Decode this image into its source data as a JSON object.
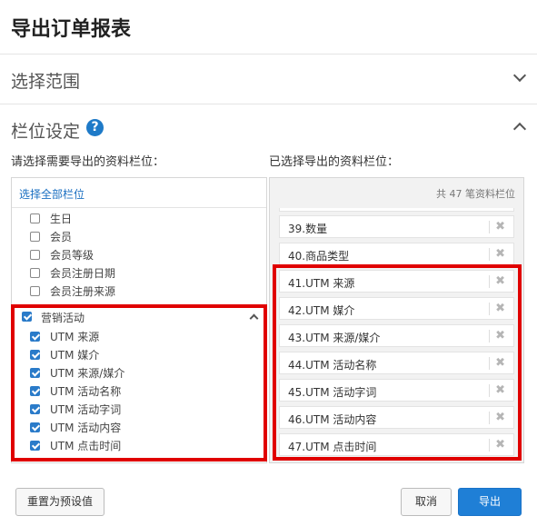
{
  "header": {
    "title": "导出订单报表"
  },
  "sections": {
    "scope": {
      "label": "选择范围"
    },
    "fields": {
      "label": "栏位设定",
      "help_glyph": "?"
    }
  },
  "left_caption": "请选择需要导出的资料栏位：",
  "right_caption": "已选择导出的资料栏位：",
  "left_panel": {
    "select_all": "选择全部栏位",
    "items": [
      {
        "label": "生日",
        "checked": false
      },
      {
        "label": "会员",
        "checked": false
      },
      {
        "label": "会员等级",
        "checked": false
      },
      {
        "label": "会员注册日期",
        "checked": false
      },
      {
        "label": "会员注册来源",
        "checked": false
      }
    ],
    "group": {
      "label": "营销活动",
      "checked": true,
      "items": [
        {
          "label": "UTM 来源",
          "checked": true
        },
        {
          "label": "UTM 媒介",
          "checked": true
        },
        {
          "label": "UTM 来源/媒介",
          "checked": true
        },
        {
          "label": "UTM 活动名称",
          "checked": true
        },
        {
          "label": "UTM 活动字词",
          "checked": true
        },
        {
          "label": "UTM 活动内容",
          "checked": true
        },
        {
          "label": "UTM 点击时间",
          "checked": true
        }
      ]
    }
  },
  "right_panel": {
    "count_label": "共 47 笔资料栏位",
    "items": [
      "39.数量",
      "40.商品类型",
      "41.UTM 来源",
      "42.UTM 媒介",
      "43.UTM 来源/媒介",
      "44.UTM 活动名称",
      "45.UTM 活动字词",
      "46.UTM 活动内容",
      "47.UTM 点击时间"
    ],
    "remove_glyph": "✖"
  },
  "footer": {
    "reset_label": "重置为预设值",
    "cancel_label": "取消",
    "export_label": "导出"
  },
  "colors": {
    "accent": "#1f7fd6",
    "highlight": "#e00000"
  }
}
